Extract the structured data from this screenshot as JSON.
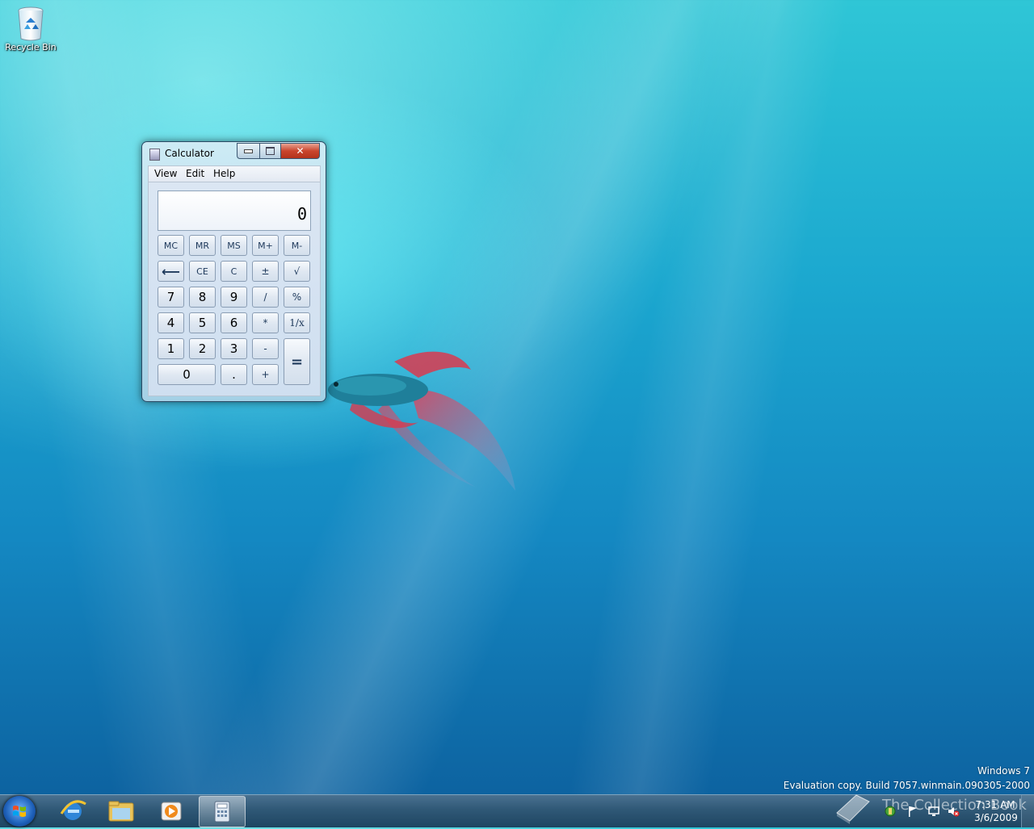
{
  "desktop": {
    "icons": [
      {
        "label": "Recycle Bin",
        "icon": "recycle-bin-icon"
      }
    ]
  },
  "calculator": {
    "title": "Calculator",
    "menu": [
      "View",
      "Edit",
      "Help"
    ],
    "display": "0",
    "memory_keys": [
      "MC",
      "MR",
      "MS",
      "M+",
      "M-"
    ],
    "row2": [
      "⟵",
      "CE",
      "C",
      "±",
      "√"
    ],
    "row3": [
      "7",
      "8",
      "9",
      "/",
      "%"
    ],
    "row4": [
      "4",
      "5",
      "6",
      "*",
      "1/x"
    ],
    "row5": [
      "1",
      "2",
      "3",
      "-"
    ],
    "row6": [
      "0",
      ".",
      "+"
    ],
    "equals": "="
  },
  "watermark": {
    "line1": "Windows 7",
    "line2": "Evaluation copy. Build 7057.winmain.090305-2000"
  },
  "taskbar": {
    "pinned": [
      "internet-explorer-icon",
      "windows-explorer-icon",
      "media-player-icon",
      "calculator-icon"
    ],
    "clock_time": "7:31 AM",
    "clock_date": "3/6/2009",
    "overlay_text": "The Collection Book"
  },
  "colors": {
    "taskbar": "#2f5876",
    "close_button": "#c9452d",
    "desktop": "#1ba7cf"
  }
}
